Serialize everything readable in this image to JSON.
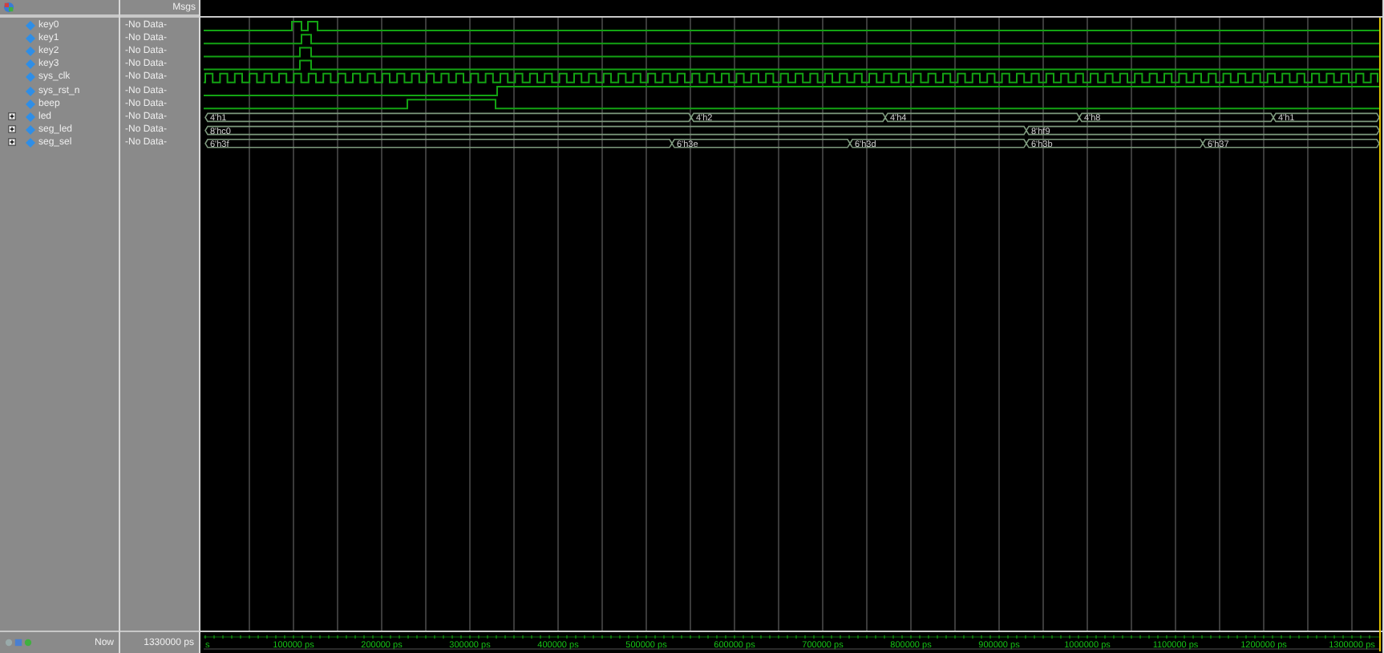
{
  "header": {
    "value_column": "Msgs"
  },
  "signals": [
    {
      "name": "key0",
      "value": "-No Data-",
      "kind": "bit"
    },
    {
      "name": "key1",
      "value": "-No Data-",
      "kind": "bit"
    },
    {
      "name": "key2",
      "value": "-No Data-",
      "kind": "bit"
    },
    {
      "name": "key3",
      "value": "-No Data-",
      "kind": "bit"
    },
    {
      "name": "sys_clk",
      "value": "-No Data-",
      "kind": "clock"
    },
    {
      "name": "sys_rst_n",
      "value": "-No Data-",
      "kind": "bit"
    },
    {
      "name": "beep",
      "value": "-No Data-",
      "kind": "bit"
    },
    {
      "name": "led",
      "value": "-No Data-",
      "kind": "bus",
      "expanded": false,
      "values": [
        "4'h1",
        "4'h2",
        "4'h4",
        "4'h8",
        "4'h1"
      ]
    },
    {
      "name": "seg_led",
      "value": "-No Data-",
      "kind": "bus",
      "expanded": false,
      "values": [
        "8'hc0",
        "8'hf9"
      ]
    },
    {
      "name": "seg_sel",
      "value": "-No Data-",
      "kind": "bus",
      "expanded": false,
      "values": [
        "6'h3f",
        "6'h3e",
        "6'h3d",
        "6'h3b",
        "6'h37"
      ]
    }
  ],
  "cursor": {
    "label": "Now",
    "time": "1330000 ps"
  },
  "time_axis": {
    "labels": [
      "s",
      "100000 ps",
      "200000 ps",
      "300000 ps",
      "400000 ps",
      "500000 ps",
      "600000 ps",
      "700000 ps",
      "800000 ps",
      "900000 ps",
      "1000000 ps",
      "1100000 ps",
      "1200000 ps",
      "1300000 ps"
    ]
  }
}
